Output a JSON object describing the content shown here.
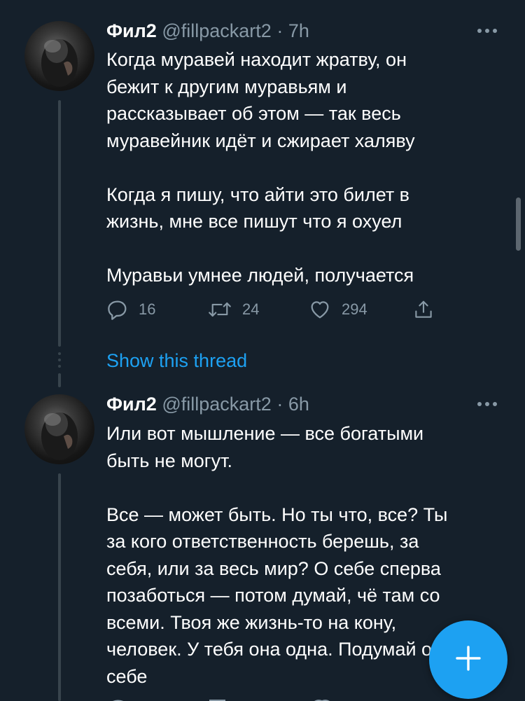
{
  "tweets": [
    {
      "author_name": "Фил2",
      "handle": "@fillpackart2",
      "separator": "·",
      "time": "7h",
      "text": "Когда муравей находит жратву, он\nбежит к другим муравьям и\nрассказывает об этом — так весь\nмуравейник идёт и сжирает халяву\n\nКогда я пишу, что айти это билет в\nжизнь, мне все пишут что я охуел\n\nМуравьи умнее людей, получается",
      "replies": "16",
      "retweets": "24",
      "likes": "294"
    },
    {
      "author_name": "Фил2",
      "handle": "@fillpackart2",
      "separator": "·",
      "time": "6h",
      "text": "Или вот мышление — все богатыми\nбыть не могут.\n\nВсе — может быть. Но ты что, все? Ты\nза кого ответственность берешь, за\nсебя, или за весь мир? О себе сперва\nпозаботься — потом думай, чё там со\nвсеми. Твоя же жизнь-то на кону,\nчеловек. У тебя она одна. Подумай о\nсебе"
    }
  ],
  "show_thread_label": "Show this thread",
  "icons": {
    "reply": "reply-icon",
    "retweet": "retweet-icon",
    "like": "heart-icon",
    "share": "share-icon",
    "more": "more-icon",
    "compose": "plus-icon"
  },
  "colors": {
    "background": "#15202b",
    "accent": "#1da1f2",
    "secondary_text": "#8899a6"
  }
}
